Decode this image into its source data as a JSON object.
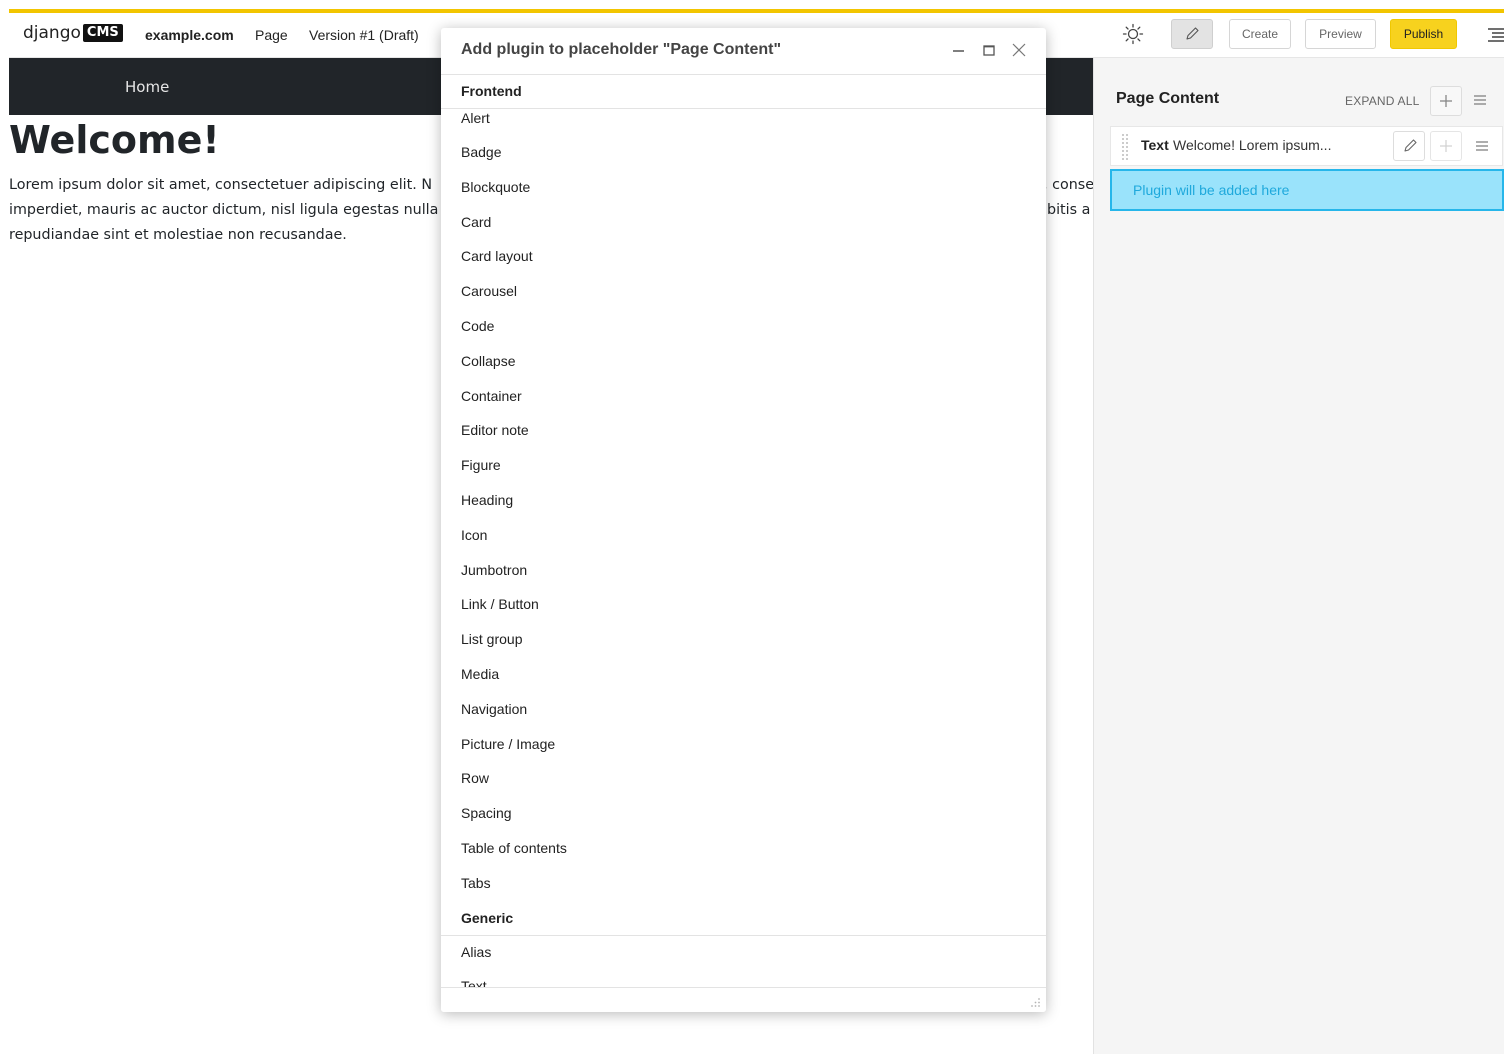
{
  "toolbar": {
    "logo_text": "django",
    "logo_badge": "CMS",
    "site": "example.com",
    "page_menu": "Page",
    "version": "Version #1 (Draft)",
    "create_label": "Create",
    "preview_label": "Preview",
    "publish_label": "Publish",
    "accent_color": "#f2c500"
  },
  "page": {
    "nav_home": "Home",
    "heading": "Welcome!",
    "lines": [
      "Lorem ipsum dolor sit amet, consectetuer adipiscing elit. N",
      "imperdiet, mauris ac auctor dictum, nisl ligula egestas nulla",
      "repudiandae sint et molestiae non recusandae."
    ],
    "right_fragments": [
      ", conse",
      "bitis a"
    ]
  },
  "structure": {
    "title": "Page Content",
    "expand_all": "EXPAND ALL",
    "plugin": {
      "type": "Text",
      "description": "Welcome! Lorem ipsum..."
    },
    "drop_label": "Plugin will be added here",
    "drop_color": "#9ae3fb"
  },
  "modal": {
    "title": "Add plugin to placeholder \"Page Content\"",
    "sections": [
      {
        "name": "Frontend",
        "items": [
          "Alert",
          "Badge",
          "Blockquote",
          "Card",
          "Card layout",
          "Carousel",
          "Code",
          "Collapse",
          "Container",
          "Editor note",
          "Figure",
          "Heading",
          "Icon",
          "Jumbotron",
          "Link / Button",
          "List group",
          "Media",
          "Navigation",
          "Picture / Image",
          "Row",
          "Spacing",
          "Table of contents",
          "Tabs"
        ]
      },
      {
        "name": "Generic",
        "items": [
          "Alias",
          "Text"
        ]
      }
    ]
  }
}
